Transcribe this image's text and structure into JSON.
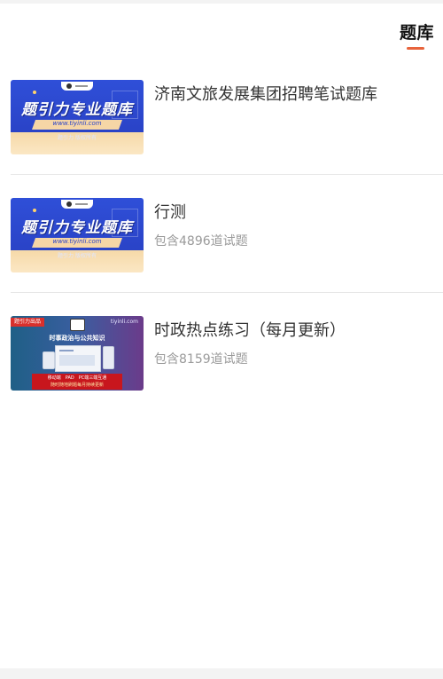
{
  "header": {
    "tab_title": "题库"
  },
  "items": [
    {
      "title": "济南文旅发展集团招聘笔试题库",
      "subtitle": "",
      "thumb": {
        "main": "题引力专业题库",
        "url": "www.tiyinli.com",
        "foot": "题引力 版权所有"
      }
    },
    {
      "title": "行测",
      "subtitle": "包含4896道试题",
      "thumb": {
        "main": "题引力专业题库",
        "url": "www.tiyinli.com",
        "foot": "题引力 版权所有"
      }
    },
    {
      "title": "时政热点练习（每月更新）",
      "subtitle": "包含8159道试题",
      "thumb": {
        "badge": "题引力出品",
        "site": "tiyinli.com",
        "title": "时事政治与公共知识",
        "bar_line1": "移动端　PAD　PC端三端互通",
        "bar_line2": "随时随地刷题每月持续更新"
      }
    }
  ],
  "colors": {
    "accent": "#e8643c",
    "divider": "#e6e6e6"
  }
}
